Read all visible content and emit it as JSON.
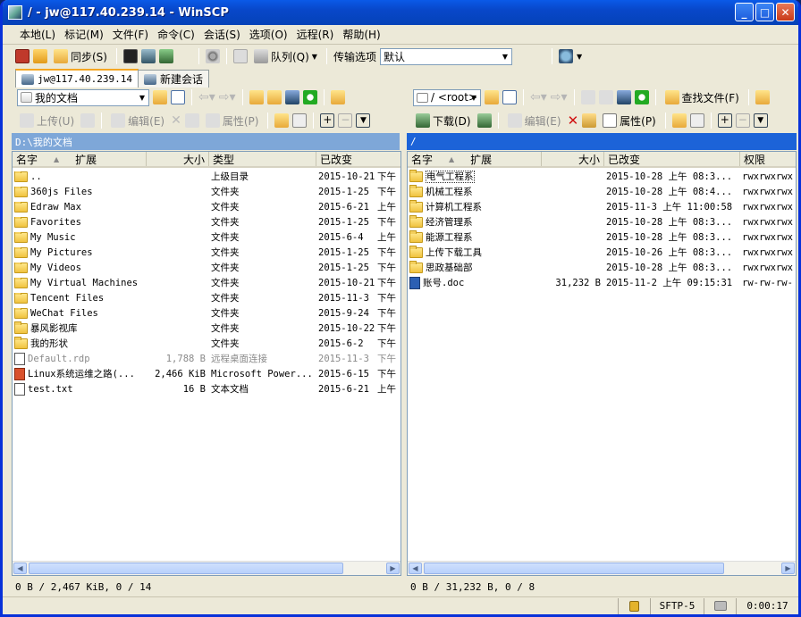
{
  "window": {
    "title": "/ - jw@117.40.239.14 - WinSCP"
  },
  "menu": [
    "本地(L)",
    "标记(M)",
    "文件(F)",
    "命令(C)",
    "会话(S)",
    "选项(O)",
    "远程(R)",
    "帮助(H)"
  ],
  "toolbar": {
    "sync_label": "同步(S)",
    "queue_label": "队列(Q)",
    "transfer_options_label": "传输选项",
    "transfer_preset": "默认"
  },
  "tabs": {
    "session": "jw@117.40.239.14",
    "new_session": "新建会话"
  },
  "left": {
    "location": "我的文档",
    "upload_label": "上传(U)",
    "edit_label": "编辑(E)",
    "props_label": "属性(P)",
    "path": "D:\\我的文档",
    "columns": {
      "name": "名字",
      "ext": "扩展",
      "size": "大小",
      "type": "类型",
      "changed": "已改变"
    },
    "rows": [
      {
        "name": "..",
        "size": "",
        "type": "上级目录",
        "changed": "2015-10-21",
        "extra": "下午",
        "icon": "up-folder-icon"
      },
      {
        "name": "360js Files",
        "size": "",
        "type": "文件夹",
        "changed": "2015-1-25",
        "extra": "下午",
        "icon": "folder-icon"
      },
      {
        "name": "Edraw Max",
        "size": "",
        "type": "文件夹",
        "changed": "2015-6-21",
        "extra": "上午",
        "icon": "folder-icon"
      },
      {
        "name": "Favorites",
        "size": "",
        "type": "文件夹",
        "changed": "2015-1-25",
        "extra": "下午",
        "icon": "star-folder-icon"
      },
      {
        "name": "My Music",
        "size": "",
        "type": "文件夹",
        "changed": "2015-6-4",
        "extra": "上午",
        "icon": "music-folder-icon"
      },
      {
        "name": "My Pictures",
        "size": "",
        "type": "文件夹",
        "changed": "2015-1-25",
        "extra": "下午",
        "icon": "pictures-folder-icon"
      },
      {
        "name": "My Videos",
        "size": "",
        "type": "文件夹",
        "changed": "2015-1-25",
        "extra": "下午",
        "icon": "videos-folder-icon"
      },
      {
        "name": "My Virtual Machines",
        "size": "",
        "type": "文件夹",
        "changed": "2015-10-21",
        "extra": "下午",
        "icon": "folder-icon"
      },
      {
        "name": "Tencent Files",
        "size": "",
        "type": "文件夹",
        "changed": "2015-11-3",
        "extra": "下午",
        "icon": "folder-icon"
      },
      {
        "name": "WeChat Files",
        "size": "",
        "type": "文件夹",
        "changed": "2015-9-24",
        "extra": "下午",
        "icon": "folder-icon"
      },
      {
        "name": "暴风影视库",
        "size": "",
        "type": "文件夹",
        "changed": "2015-10-22",
        "extra": "下午",
        "icon": "folder-icon"
      },
      {
        "name": "我的形状",
        "size": "",
        "type": "文件夹",
        "changed": "2015-6-2",
        "extra": "下午",
        "icon": "shapes-folder-icon"
      },
      {
        "name": "Default.rdp",
        "size": "1,788 B",
        "type": "远程桌面连接",
        "changed": "2015-11-3",
        "extra": "下午",
        "icon": "rdp-file-icon",
        "hidden": true
      },
      {
        "name": "Linux系统运维之路(...",
        "size": "2,466 KiB",
        "type": "Microsoft Power...",
        "changed": "2015-6-15",
        "extra": "下午",
        "icon": "ppt-file-icon"
      },
      {
        "name": "test.txt",
        "size": "16 B",
        "type": "文本文档",
        "changed": "2015-6-21",
        "extra": "上午",
        "icon": "text-file-icon"
      }
    ],
    "status": "0 B / 2,467 KiB, 0 / 14"
  },
  "right": {
    "location": "/ <root>",
    "find_label": "查找文件(F)",
    "download_label": "下载(D)",
    "edit_label": "编辑(E)",
    "props_label": "属性(P)",
    "path": "/",
    "columns": {
      "name": "名字",
      "ext": "扩展",
      "size": "大小",
      "changed": "已改变",
      "rights": "权限"
    },
    "rows": [
      {
        "name": "电气工程系",
        "size": "",
        "changed": "2015-10-28 上午 08:3...",
        "rights": "rwxrwxrwx",
        "icon": "folder-icon"
      },
      {
        "name": "机械工程系",
        "size": "",
        "changed": "2015-10-28 上午 08:4...",
        "rights": "rwxrwxrwx",
        "icon": "folder-icon"
      },
      {
        "name": "计算机工程系",
        "size": "",
        "changed": "2015-11-3 上午 11:00:58",
        "rights": "rwxrwxrwx",
        "icon": "folder-icon"
      },
      {
        "name": "经济管理系",
        "size": "",
        "changed": "2015-10-28 上午 08:3...",
        "rights": "rwxrwxrwx",
        "icon": "folder-icon"
      },
      {
        "name": "能源工程系",
        "size": "",
        "changed": "2015-10-28 上午 08:3...",
        "rights": "rwxrwxrwx",
        "icon": "folder-icon"
      },
      {
        "name": "上传下载工具",
        "size": "",
        "changed": "2015-10-26 上午 08:3...",
        "rights": "rwxrwxrwx",
        "icon": "folder-icon"
      },
      {
        "name": "思政基础部",
        "size": "",
        "changed": "2015-10-28 上午 08:3...",
        "rights": "rwxrwxrwx",
        "icon": "folder-icon"
      },
      {
        "name": "账号.doc",
        "size": "31,232 B",
        "changed": "2015-11-2 上午 09:15:31",
        "rights": "rw-rw-rw-",
        "icon": "doc-file-icon"
      }
    ],
    "status": "0 B / 31,232 B, 0 / 8"
  },
  "statusbar": {
    "protocol": "SFTP-5",
    "elapsed": "0:00:17"
  }
}
